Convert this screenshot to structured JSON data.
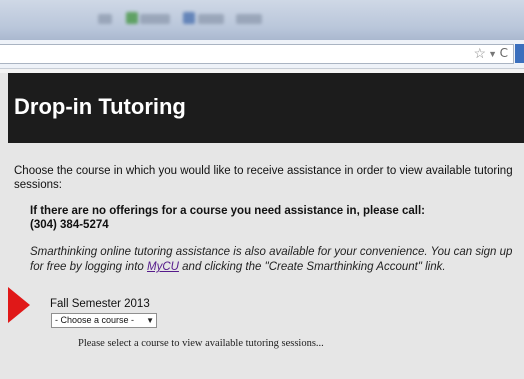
{
  "browser": {
    "star_glyph": "☆",
    "dropdown_glyph": "▼",
    "reload_glyph": "C"
  },
  "header": {
    "title": "Drop-in Tutoring"
  },
  "content": {
    "intro": "Choose the course in which you would like to receive assistance in order to view available tutoring sessions:",
    "call_line1": "If there are no offerings for a course you need assistance in, please call:",
    "call_line2": "(304) 384-5274",
    "smart_before": "Smarthinking online tutoring assistance is also available for your convenience. You can sign up for free by logging into ",
    "smart_link": "MyCU",
    "smart_after": " and clicking the \"Create Smarthinking Account\" link.",
    "semester": "Fall Semester 2013",
    "course_select": "- Choose a course -",
    "select_message": "Please select a course to view available tutoring sessions..."
  },
  "colors": {
    "header_bg": "#1c1c1c",
    "page_bg": "#e6e6e6",
    "arrow": "#e01818",
    "link": "#551a8b"
  }
}
